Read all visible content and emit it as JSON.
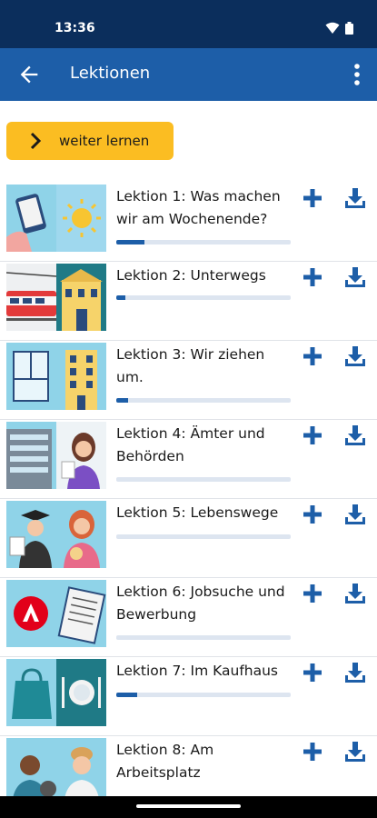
{
  "status": {
    "time": "13:36"
  },
  "appbar": {
    "title": "Lektionen"
  },
  "cta": {
    "label": "weiter lernen"
  },
  "lessons": [
    {
      "title": "Lektion 1: Was machen wir am Wochenende?",
      "progress": 0.16
    },
    {
      "title": "Lektion 2: Unterwegs",
      "progress": 0.05
    },
    {
      "title": "Lektion 3: Wir ziehen um.",
      "progress": 0.07
    },
    {
      "title": "Lektion 4: Ämter und Behörden",
      "progress": 0.0
    },
    {
      "title": "Lektion 5: Lebenswege",
      "progress": 0.0
    },
    {
      "title": "Lektion 6: Jobsuche und Bewerbung",
      "progress": 0.0
    },
    {
      "title": "Lektion 7: Im Kaufhaus",
      "progress": 0.12
    },
    {
      "title": "Lektion 8: Am Arbeitsplatz",
      "progress": 0.0
    }
  ],
  "colors": {
    "statusbar": "#0b2e5c",
    "appbar": "#1d5ea8",
    "accent": "#fbbd22",
    "icon": "#1d5ea8"
  },
  "icons": {
    "back": "arrow-left-icon",
    "more": "more-vert-icon",
    "add": "plus-icon",
    "download": "download-icon"
  }
}
